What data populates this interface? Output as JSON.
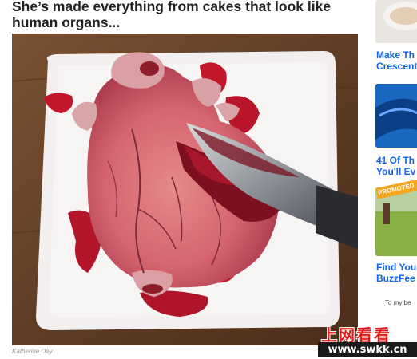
{
  "article": {
    "headline": "She’s made everything from cakes that look like human organs...",
    "photo_credit": "Katherine Dey"
  },
  "sidebar": {
    "items": [
      {
        "title_line1": "Make Th",
        "title_line2": "Crescent"
      },
      {
        "title_line1": "41 Of Th",
        "title_line2": "You'll Ev"
      },
      {
        "title_line1": "Find You",
        "title_line2": "BuzzFee",
        "badge": "PROMOTED"
      }
    ],
    "note": "To my be"
  },
  "watermark": {
    "chinese": "上网看看",
    "url": "www.swkk.cn"
  },
  "colors": {
    "link": "#0f65ef",
    "promoted": "#f3a622",
    "watermark_red": "#e01a1a"
  }
}
